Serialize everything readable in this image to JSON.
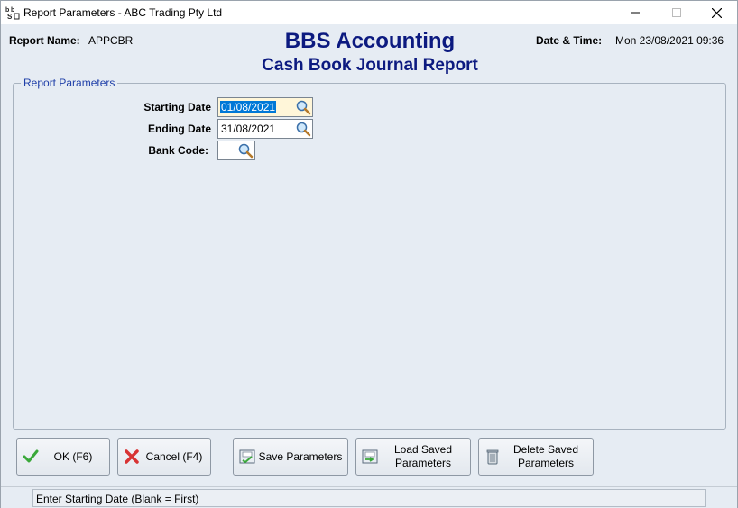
{
  "window": {
    "title": "Report Parameters - ABC Trading Pty Ltd",
    "minimize_glyph": "—",
    "maximize_glyph": "☐",
    "close_glyph": "✕"
  },
  "header": {
    "report_name_label": "Report Name:",
    "report_name": "APPCBR",
    "title": "BBS Accounting",
    "subtitle": "Cash Book Journal Report",
    "datetime_label": "Date & Time:",
    "datetime": "Mon 23/08/2021 09:36"
  },
  "parameters": {
    "group_title": "Report Parameters",
    "starting_date_label": "Starting Date",
    "starting_date": "01/08/2021",
    "ending_date_label": "Ending Date",
    "ending_date": "31/08/2021",
    "bank_code_label": "Bank Code:",
    "bank_code": ""
  },
  "buttons": {
    "ok": "OK (F6)",
    "cancel": "Cancel (F4)",
    "save": "Save Parameters",
    "load_line1": "Load Saved",
    "load_line2": "Parameters",
    "delete_line1": "Delete Saved",
    "delete_line2": "Parameters"
  },
  "status": {
    "message": "Enter Starting Date (Blank = First)"
  },
  "colors": {
    "title_blue": "#0c1a80",
    "group_blue": "#1f3fa8",
    "window_bg": "#e6ecf3",
    "selection": "#0078d7"
  },
  "icons": {
    "app": "bbs-app-icon",
    "lookup": "magnifier-icon",
    "ok": "green-check-icon",
    "cancel": "red-x-icon",
    "save": "save-icon",
    "load": "load-icon",
    "delete": "trash-icon"
  }
}
